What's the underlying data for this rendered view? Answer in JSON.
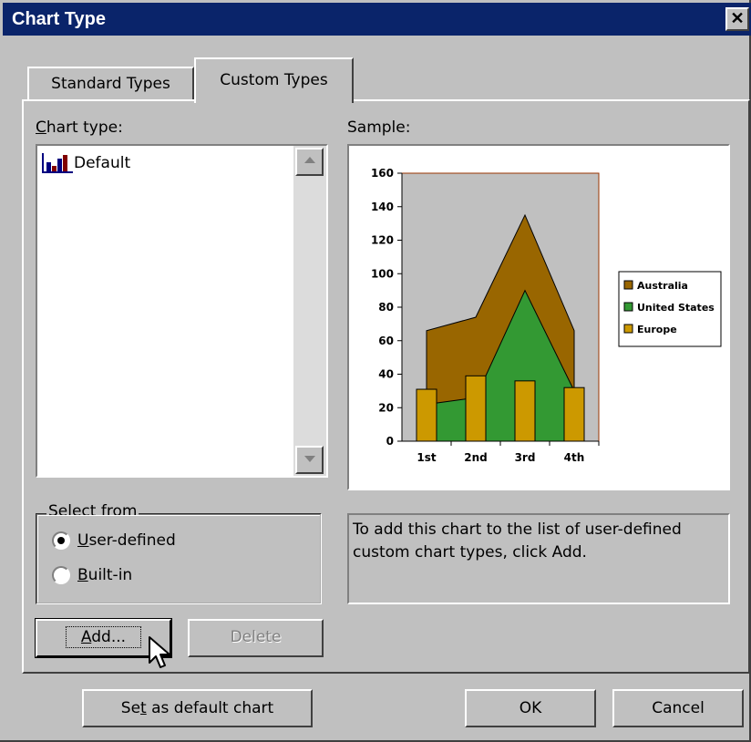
{
  "window": {
    "title": "Chart Type",
    "close_glyph": "✕"
  },
  "tabs": [
    {
      "label": "Standard Types",
      "selected": false
    },
    {
      "label": "Custom Types",
      "selected": true
    }
  ],
  "chart_type": {
    "label_prefix": "C",
    "label_rest": "hart type:",
    "items": [
      {
        "label": "Default",
        "icon": "bar-chart-icon"
      }
    ]
  },
  "sample": {
    "label": "Sample:",
    "chart_data": {
      "type": "area",
      "categories": [
        "1st",
        "2nd",
        "3rd",
        "4th"
      ],
      "ylim": [
        0,
        160
      ],
      "yticks": [
        0,
        20,
        40,
        60,
        80,
        100,
        120,
        140,
        160
      ],
      "series": [
        {
          "name": "Australia",
          "kind": "area",
          "values": [
            66,
            74,
            135,
            66
          ],
          "color": "#996600"
        },
        {
          "name": "United States",
          "kind": "area",
          "values": [
            22,
            26,
            90,
            30
          ],
          "color": "#339933"
        },
        {
          "name": "Europe",
          "kind": "bar",
          "values": [
            31,
            39,
            36,
            32
          ],
          "color": "#cc9900"
        }
      ],
      "legend_position": "right",
      "plot_background": "#c0c0c0"
    }
  },
  "select_from": {
    "label": "Select from",
    "options": [
      {
        "prefix": "",
        "accel": "U",
        "rest": "ser-defined",
        "checked": true
      },
      {
        "prefix": "",
        "accel": "B",
        "rest": "uilt-in",
        "checked": false
      }
    ]
  },
  "description": "To add this chart to the list of user-defined custom chart types, click Add.",
  "buttons": {
    "add": {
      "accel": "A",
      "rest": "dd..."
    },
    "delete": "Delete",
    "set_default": {
      "prefix": "Se",
      "accel": "t",
      "rest": " as default chart"
    },
    "ok": "OK",
    "cancel": "Cancel"
  }
}
